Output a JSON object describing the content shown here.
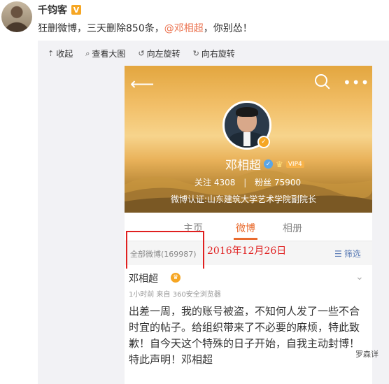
{
  "post": {
    "author": "千钧客",
    "vip_badge": "V",
    "text_before": "狂删微博，三天删除850条，",
    "mention": "@邓相超",
    "text_after": "，你别怂！"
  },
  "media_toolbar": {
    "collapse": "收起",
    "view_large": "查看大图",
    "rotate_left": "向左旋转",
    "rotate_right": "向右旋转"
  },
  "screenshot": {
    "profile_name": "邓相超",
    "vip_level": "VIP4",
    "following_label": "关注",
    "following_count": "4308",
    "followers_label": "粉丝",
    "followers_count": "75900",
    "certification": "微博认证:山东建筑大学艺术学院副院长",
    "tabs": [
      "主页",
      "微博",
      "相册"
    ],
    "active_tab": "微博",
    "all_posts": "全部微博(169987)",
    "filter": "筛选",
    "date_annotation": "2016年12月26日",
    "post_author": "邓相超",
    "post_meta": "1小时前  来自 360安全浏览器",
    "post_body": "出差一周，我的账号被盗，不知何人发了一些不合时宜的帖子。给组织带来了不必要的麻烦，特此致歉！自今天这个特殊的日子开始，自我主动封博！特此声明！邓相超"
  },
  "watermark": "罗森详",
  "colors": {
    "mention": "#eb7350",
    "accent_tab": "#e96b2e",
    "annotation_red": "#e02020"
  }
}
